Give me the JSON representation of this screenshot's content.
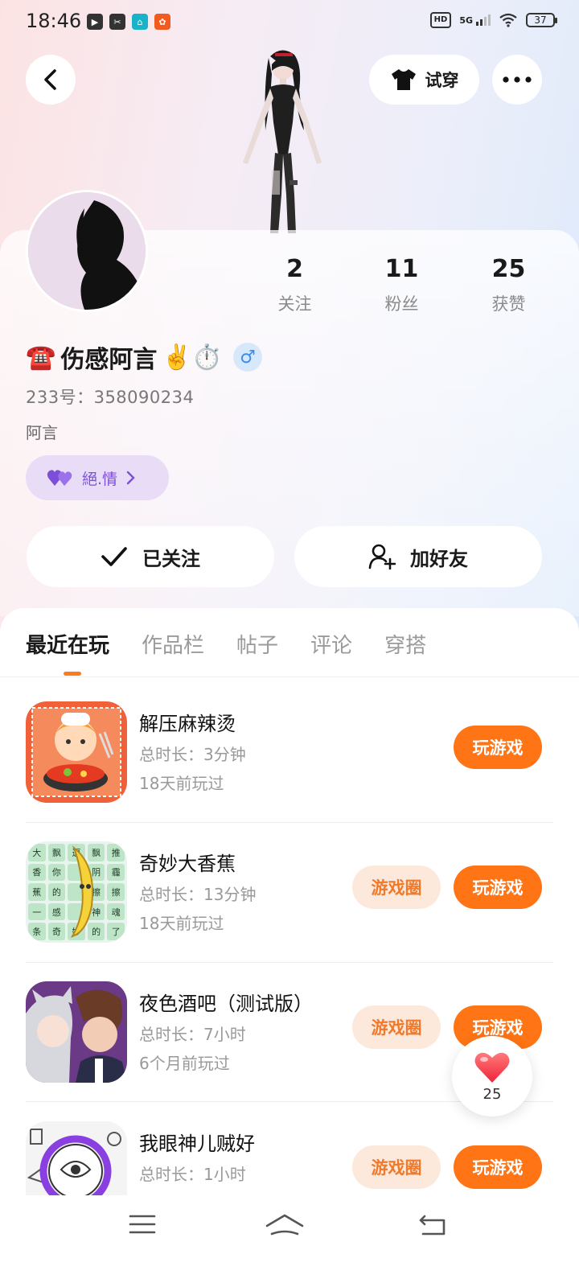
{
  "status_bar": {
    "time": "18:46",
    "network": "5G",
    "hd": "HD",
    "battery": "37"
  },
  "header": {
    "try_on_label": "试穿"
  },
  "profile": {
    "stats": [
      {
        "value": "2",
        "label": "关注"
      },
      {
        "value": "11",
        "label": "粉丝"
      },
      {
        "value": "25",
        "label": "获赞"
      }
    ],
    "nickname_prefix": "☎️",
    "nickname": "伤感阿言",
    "nickname_suffix": "✌️⏱️",
    "gender_symbol": "♂",
    "uid": "233号：358090234",
    "bio": "阿言",
    "partner_label": "絕.情",
    "follow_label": "已关注",
    "add_friend_label": "加好友"
  },
  "tabs": [
    {
      "label": "最近在玩",
      "active": true
    },
    {
      "label": "作品栏",
      "active": false
    },
    {
      "label": "帖子",
      "active": false
    },
    {
      "label": "评论",
      "active": false
    },
    {
      "label": "穿搭",
      "active": false
    }
  ],
  "games": [
    {
      "name": "解压麻辣烫",
      "time": "总时长：3分钟",
      "last": "18天前玩过",
      "circle": "",
      "play": "玩游戏"
    },
    {
      "name": "奇妙大香蕉",
      "time": "总时长：13分钟",
      "last": "18天前玩过",
      "circle": "游戏圈",
      "play": "玩游戏"
    },
    {
      "name": "夜色酒吧（测试版）",
      "time": "总时长：7小时",
      "last": "6个月前玩过",
      "circle": "游戏圈",
      "play": "玩游戏"
    },
    {
      "name": "我眼神儿贼好",
      "time": "总时长：1小时",
      "last": "",
      "circle": "游戏圈",
      "play": "玩游戏"
    }
  ],
  "banana_grid": [
    "大",
    "飘",
    "逗",
    "飘",
    "推",
    "香",
    "你",
    "",
    "阴",
    "霾",
    "蕉",
    "的",
    "",
    "擦",
    "擦",
    "一",
    "感",
    "",
    "神",
    "魂",
    "条",
    "奇",
    "妙",
    "的",
    "了"
  ],
  "like_float": {
    "count": "25"
  },
  "colors": {
    "accent": "#ff7414",
    "circle_bg": "#fde9dc",
    "partner": "#7b4fd6"
  }
}
